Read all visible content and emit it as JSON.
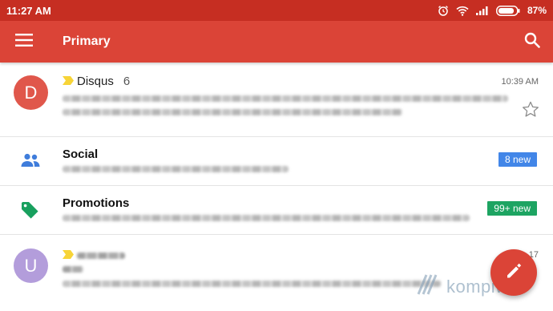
{
  "status_bar": {
    "time": "11:27 AM",
    "battery_percent": "87%",
    "icons": [
      "alarm-icon",
      "wifi-icon",
      "signal-icon",
      "battery-icon"
    ]
  },
  "app_bar": {
    "title": "Primary",
    "icons": [
      "menu-icon",
      "search-icon"
    ],
    "color": "#db4437"
  },
  "inbox": {
    "emails": [
      {
        "avatar_letter": "D",
        "avatar_color": "#e0574b",
        "sender": "Disqus",
        "thread_count": "6",
        "time": "10:39 AM",
        "important": true,
        "starred": false
      },
      {
        "avatar_letter": "U",
        "avatar_color": "#b39ddb",
        "sender": "",
        "time": "17",
        "important": true
      }
    ],
    "categories": [
      {
        "title": "Social",
        "icon": "people-icon",
        "icon_color": "#3f7ddb",
        "badge": "8 new",
        "badge_color": "#4286e8"
      },
      {
        "title": "Promotions",
        "icon": "tag-icon",
        "icon_color": "#18a05e",
        "badge": "99+ new",
        "badge_color": "#1da462"
      }
    ]
  },
  "fab": {
    "icon": "pencil-icon"
  },
  "watermark": {
    "text": "kompiwin"
  }
}
